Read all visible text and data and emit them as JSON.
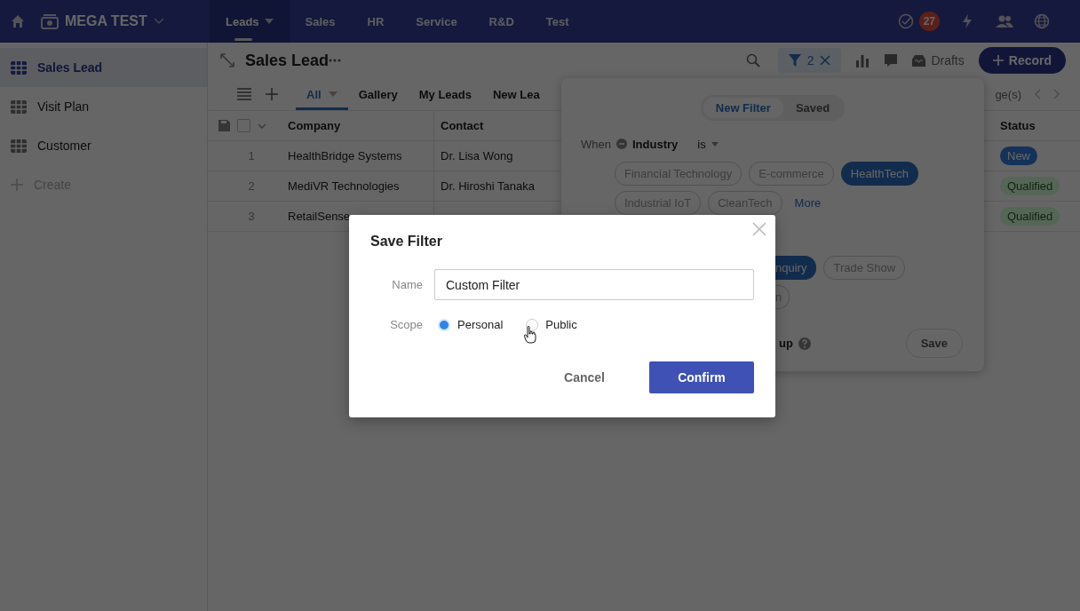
{
  "topbar": {
    "app_name": "MEGA TEST",
    "nav": [
      {
        "label": "Leads",
        "selected": true
      },
      {
        "label": "Sales",
        "selected": false
      },
      {
        "label": "HR",
        "selected": false
      },
      {
        "label": "Service",
        "selected": false
      },
      {
        "label": "R&D",
        "selected": false
      },
      {
        "label": "Test",
        "selected": false
      }
    ],
    "task_count": "27"
  },
  "sidebar": {
    "items": [
      {
        "label": "Sales Lead",
        "selected": true
      },
      {
        "label": "Visit Plan",
        "selected": false
      },
      {
        "label": "Customer",
        "selected": false
      }
    ],
    "create": "Create"
  },
  "header": {
    "title": "Sales Lead",
    "filter_count": "2",
    "drafts": "Drafts",
    "record_button": "Record"
  },
  "views": {
    "tabs": [
      {
        "label": "All",
        "selected": true
      },
      {
        "label": "Gallery",
        "selected": false
      },
      {
        "label": "My Leads",
        "selected": false
      },
      {
        "label": "New Lea",
        "selected": false
      }
    ],
    "pager": "ge(s)"
  },
  "table": {
    "columns": [
      "Company",
      "Contact",
      "Status"
    ],
    "rows": [
      {
        "number": "1",
        "company": "HealthBridge Systems",
        "contact": "Dr. Lisa Wong",
        "status": "New",
        "color": "#14325a"
      },
      {
        "number": "2",
        "company": "MediVR Technologies",
        "contact": "Dr. Hiroshi Tanaka",
        "status": "Qualified",
        "color": "#566656"
      },
      {
        "number": "3",
        "company": "RetailSense",
        "status": "Qualified",
        "color": "#566656"
      }
    ],
    "select_all_checked": false
  },
  "filter_panel": {
    "tabs": [
      {
        "label": "New Filter",
        "selected": true
      },
      {
        "label": "Saved",
        "selected": false
      }
    ],
    "when": "When",
    "field": "Industry",
    "operator": "is",
    "options": [
      {
        "label": "Financial Technology",
        "selected": false
      },
      {
        "label": "E-commerce",
        "selected": false
      },
      {
        "label": "HealthTech",
        "selected": true
      },
      {
        "label": "Industrial IoT",
        "selected": false
      },
      {
        "label": "CleanTech",
        "selected": false
      }
    ],
    "more": "More",
    "source_options": [
      {
        "label": "nquiry",
        "selected": true
      },
      {
        "label": "Trade Show",
        "selected": false
      }
    ],
    "source_fragment": "n",
    "group_fragment": "up",
    "save": "Save"
  },
  "modal": {
    "title": "Save Filter",
    "name_label": "Name",
    "name_value": "Custom Filter",
    "scope_label": "Scope",
    "scope_options": [
      {
        "label": "Personal",
        "selected": true
      },
      {
        "label": "Public",
        "selected": false
      }
    ],
    "cancel": "Cancel",
    "confirm": "Confirm"
  }
}
